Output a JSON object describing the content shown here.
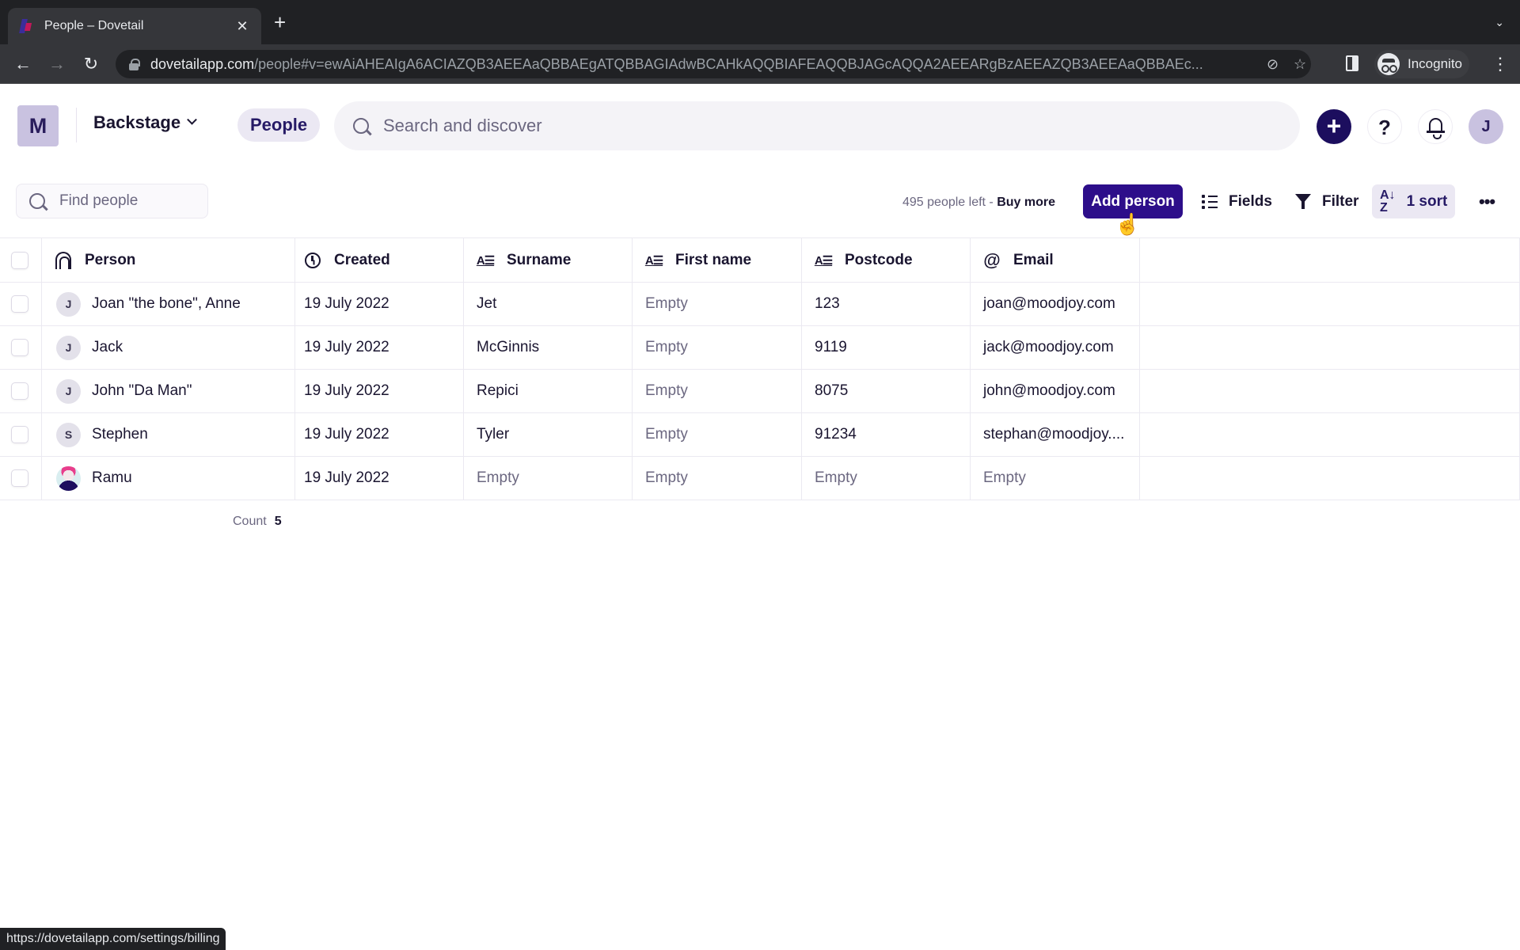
{
  "browser": {
    "tab_title": "People – Dovetail",
    "url_host": "dovetailapp.com",
    "url_path": "/people#v=ewAiAHEAIgA6ACIAZQB3AEEAaQBBAEgATQBBAGIAdwBCAHkAQQBIAFEAQQBJAGcAQQA2AEEARgBzAEEAZQB3AEEAaQBBAEc...",
    "profile_label": "Incognito",
    "status_url": "https://dovetailapp.com/settings/billing"
  },
  "header": {
    "workspace_initial": "M",
    "workspace_name": "Backstage",
    "nav_active": "People",
    "search_placeholder": "Search and discover",
    "help_label": "?",
    "user_initial": "J",
    "add_label": "+"
  },
  "toolbar": {
    "find_placeholder": "Find people",
    "quota_text": "495 people left - ",
    "buy_more": "Buy more",
    "add_person": "Add person",
    "fields": "Fields",
    "filter": "Filter",
    "sort": "1 sort",
    "more": "•••"
  },
  "table": {
    "columns": [
      {
        "label": "Person",
        "icon": "fingerprint-icon"
      },
      {
        "label": "Created",
        "icon": "clock-icon"
      },
      {
        "label": "Surname",
        "icon": "text-field-icon"
      },
      {
        "label": "First name",
        "icon": "text-field-icon"
      },
      {
        "label": "Postcode",
        "icon": "text-field-icon"
      },
      {
        "label": "Email",
        "icon": "at-sign-icon"
      }
    ],
    "rows": [
      {
        "initial": "J",
        "person": "Joan \"the bone\", Anne",
        "created": "19 July 2022",
        "surname": "Jet",
        "first_name": "Empty",
        "postcode": "123",
        "email": "joan@moodjoy.com"
      },
      {
        "initial": "J",
        "person": "Jack",
        "created": "19 July 2022",
        "surname": "McGinnis",
        "first_name": "Empty",
        "postcode": "9119",
        "email": "jack@moodjoy.com"
      },
      {
        "initial": "J",
        "person": "John \"Da Man\"",
        "created": "19 July 2022",
        "surname": "Repici",
        "first_name": "Empty",
        "postcode": "8075",
        "email": "john@moodjoy.com"
      },
      {
        "initial": "S",
        "person": "Stephen",
        "created": "19 July 2022",
        "surname": "Tyler",
        "first_name": "Empty",
        "postcode": "91234",
        "email": "stephan@moodjoy...."
      },
      {
        "initial": "",
        "person": "Ramu",
        "created": "19 July 2022",
        "surname": "Empty",
        "first_name": "Empty",
        "postcode": "Empty",
        "email": "Empty"
      }
    ],
    "count_label": "Count",
    "count_value": "5"
  },
  "colors": {
    "brand_dark": "#1c0e5e",
    "add_person_bg": "#2d0e8a",
    "chip_bg": "#ebe8f3"
  }
}
